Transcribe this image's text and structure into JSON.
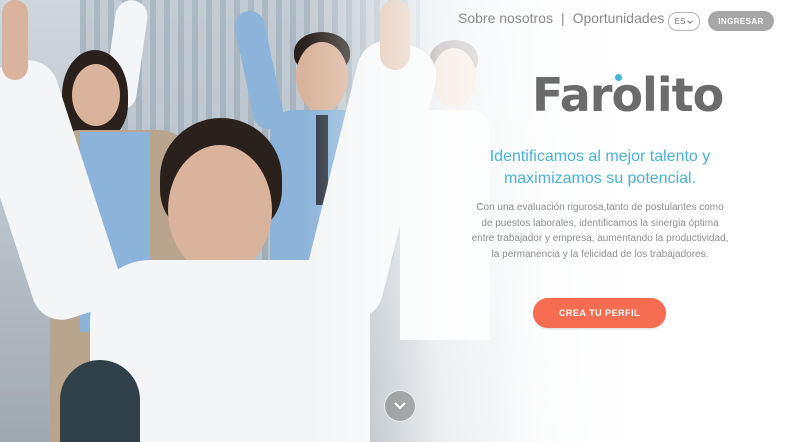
{
  "header": {
    "nav": [
      {
        "label": "Sobre nosotros"
      },
      {
        "label": "Oportunidades"
      }
    ],
    "separator": "|",
    "language": {
      "selected": "ES",
      "icon": "chevron-down-icon"
    },
    "login_label": "INGRESAR"
  },
  "hero": {
    "logo_text": "Farolito",
    "headline_line1": "Identificamos al mejor talento y",
    "headline_line2": "maximizamos su potencial.",
    "description": "Con una evaluación rigurosa,tanto de postulantes como de puestos laborales, identificamos la sinergia óptima entre trabajador y empresa, aumentando la productividad, la permanencia y la felicidad de los trabajadores.",
    "cta_label": "CREA TU PERFIL",
    "scroll_icon": "chevron-down-icon"
  },
  "colors": {
    "accent_blue": "#4ab2d4",
    "cta_orange": "#f56c50",
    "login_gray": "#a7a7a7",
    "logo_gray": "#6b6b6b"
  }
}
